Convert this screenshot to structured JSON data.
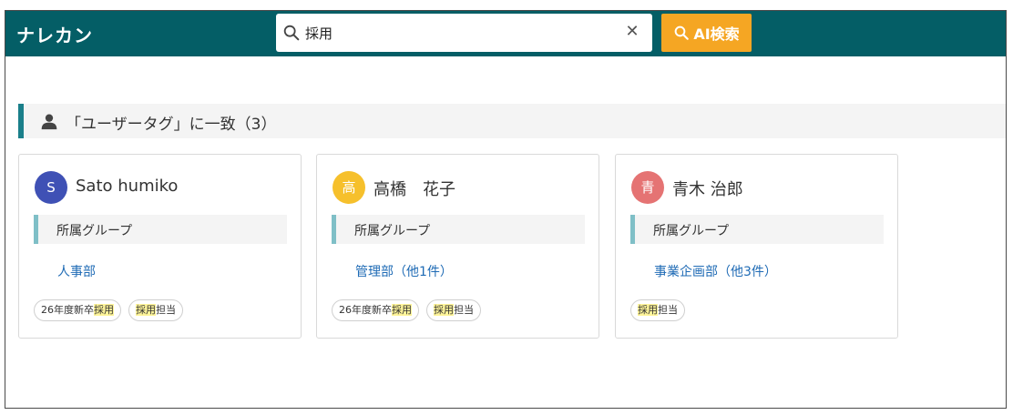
{
  "app": {
    "logo": "ナレカン"
  },
  "search": {
    "value": "採用",
    "placeholder": "",
    "ai_button_label": "AI検索"
  },
  "section": {
    "title": "「ユーザータグ」に一致（3）"
  },
  "cards": [
    {
      "avatar_letter": "S",
      "avatar_color": "#3f51b5",
      "name": "Sato humiko",
      "group_label": "所属グループ",
      "group_value": "人事部",
      "tags": [
        {
          "prefix": "26年度新卒",
          "highlight": "採用",
          "suffix": ""
        },
        {
          "prefix": "",
          "highlight": "採用",
          "suffix": "担当"
        }
      ]
    },
    {
      "avatar_letter": "高",
      "avatar_color": "#f6c02c",
      "name": "高橋　花子",
      "group_label": "所属グループ",
      "group_value": "管理部（他1件）",
      "tags": [
        {
          "prefix": "26年度新卒",
          "highlight": "採用",
          "suffix": ""
        },
        {
          "prefix": "",
          "highlight": "採用",
          "suffix": "担当"
        }
      ]
    },
    {
      "avatar_letter": "青",
      "avatar_color": "#e57373",
      "name": "青木 治郎",
      "group_label": "所属グループ",
      "group_value": "事業企画部（他3件）",
      "tags": [
        {
          "prefix": "",
          "highlight": "採用",
          "suffix": "担当"
        }
      ]
    }
  ],
  "colors": {
    "header": "#045e66",
    "accent_button": "#f5a623",
    "section_accent": "#1a7f8a",
    "highlight": "#fff59a",
    "link": "#1f6bb5"
  },
  "icons": {
    "search": "search-icon",
    "clear": "close-icon",
    "ai": "search-icon",
    "section": "person-icon"
  }
}
